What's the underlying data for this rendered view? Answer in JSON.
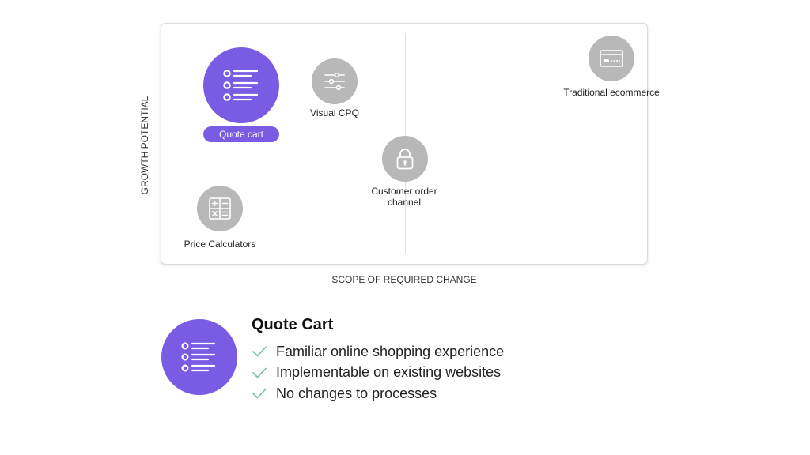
{
  "axes": {
    "y_label": "GROWTH POTENTIAL",
    "x_label": "SCOPE OF REQUIRED CHANGE"
  },
  "nodes": [
    {
      "label": "Quote cart",
      "icon": "list-icon",
      "highlighted": true
    },
    {
      "label": "Visual CPQ",
      "icon": "sliders-icon"
    },
    {
      "label": "Traditional ecommerce",
      "icon": "credit-card-icon"
    },
    {
      "label_line1": "Customer order",
      "label_line2": "channel",
      "icon": "lock-icon"
    },
    {
      "label": "Price Calculators",
      "icon": "calculator-icon"
    }
  ],
  "detail": {
    "title": "Quote Cart",
    "icon": "list-icon",
    "features": [
      "Familiar online shopping experience",
      "Implementable on existing websites",
      "No changes to processes"
    ]
  },
  "colors": {
    "accent": "#7a5be3",
    "node_gray": "#b8b8b8",
    "check": "#6fbfa6"
  }
}
